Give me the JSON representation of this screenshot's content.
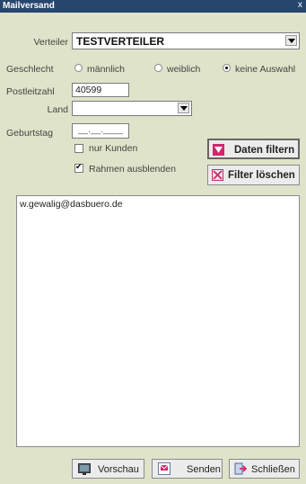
{
  "window": {
    "title": "Mailversand",
    "close_label": "x"
  },
  "verteiler": {
    "label": "Verteiler",
    "value": "TESTVERTEILER"
  },
  "geschlecht": {
    "label": "Geschlecht",
    "options": [
      "männlich",
      "weiblich",
      "keine Auswahl"
    ],
    "selected": "keine Auswahl"
  },
  "postleitzahl": {
    "label": "Postleitzahl",
    "value": "40599"
  },
  "land": {
    "label": "Land",
    "value": ""
  },
  "geburtstag": {
    "label": "Geburtstag",
    "value": "__.__.____"
  },
  "checkboxes": {
    "nur_kunden": {
      "label": "nur Kunden",
      "checked": false
    },
    "rahmen": {
      "label": "Rahmen ausblenden",
      "checked": true
    }
  },
  "buttons": {
    "filtern": "Daten filtern",
    "loeschen": "Filter löschen",
    "vorschau": "Vorschau",
    "senden": "Senden",
    "schliessen": "Schließen"
  },
  "results": [
    "w.gewalig@dasbuero.de"
  ],
  "colors": {
    "titlebar": "#26466e",
    "background": "#dfe3c9",
    "filter_icon": "#d6246c"
  }
}
